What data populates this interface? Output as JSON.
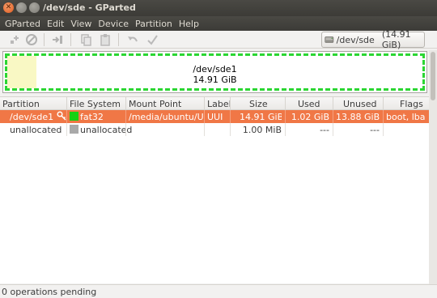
{
  "window": {
    "title": "/dev/sde - GParted"
  },
  "menubar": {
    "items": [
      "GParted",
      "Edit",
      "View",
      "Device",
      "Partition",
      "Help"
    ]
  },
  "toolbar": {
    "buttons": [
      "new-partition-icon",
      "delete-icon",
      "resize-move-icon",
      "copy-icon",
      "paste-icon",
      "undo-icon",
      "apply-icon"
    ]
  },
  "device_selector": {
    "device": "/dev/sde",
    "size": "(14.91 GiB)"
  },
  "disk_map": {
    "partition_name": "/dev/sde1",
    "partition_size": "14.91 GiB",
    "used_fraction": 0.07,
    "border_color": "#2bd632",
    "used_color": "#f9f8c4"
  },
  "table": {
    "headers": [
      "Partition",
      "File System",
      "Mount Point",
      "Label",
      "Size",
      "Used",
      "Unused",
      "Flags"
    ],
    "rows": [
      {
        "partition": "/dev/sde1",
        "filesystem": "fat32",
        "fs_color": "#17d013",
        "mount_point": "/media/ubuntu/UUI",
        "label": "UUI",
        "size": "14.91 GiB",
        "used": "1.02 GiB",
        "unused": "13.88 GiB",
        "flags": "boot, lba",
        "selected": true
      },
      {
        "partition": "unallocated",
        "filesystem": "unallocated",
        "fs_color": "#a9a9a9",
        "mount_point": "",
        "label": "",
        "size": "1.00 MiB",
        "used": "---",
        "unused": "---",
        "flags": "",
        "selected": false
      }
    ]
  },
  "status": {
    "text": "0 operations pending"
  },
  "colors": {
    "selection": "#f07746",
    "titlebar": "#3c3b37",
    "close_button": "#e05b1f"
  }
}
